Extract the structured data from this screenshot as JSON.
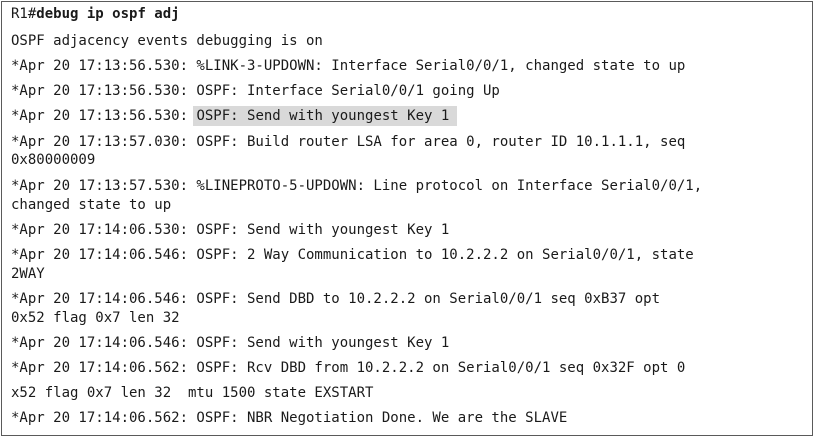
{
  "terminal": {
    "prompt": "R1#",
    "command": "debug ip ospf adj",
    "lines": [
      "OSPF adjacency events debugging is on",
      "*Apr 20 17:13:56.530: %LINK-3-UPDOWN: Interface Serial0/0/1, changed state to up",
      "*Apr 20 17:13:56.530: OSPF: Interface Serial0/0/1 going Up",
      "*Apr 20 17:13:56.530: ",
      "*Apr 20 17:13:57.030: OSPF: Build router LSA for area 0, router ID 10.1.1.1, seq",
      "0x80000009",
      "*Apr 20 17:13:57.530: %LINEPROTO-5-UPDOWN: Line protocol on Interface Serial0/0/1,",
      "changed state to up",
      "*Apr 20 17:14:06.530: OSPF: Send with youngest Key 1",
      "*Apr 20 17:14:06.546: OSPF: 2 Way Communication to 10.2.2.2 on Serial0/0/1, state",
      "2WAY",
      "*Apr 20 17:14:06.546: OSPF: Send DBD to 10.2.2.2 on Serial0/0/1 seq 0xB37 opt",
      "0x52 flag 0x7 len 32",
      "*Apr 20 17:14:06.546: OSPF: Send with youngest Key 1",
      "*Apr 20 17:14:06.562: OSPF: Rcv DBD from 10.2.2.2 on Serial0/0/1 seq 0x32F opt 0",
      "x52 flag 0x7 len 32  mtu 1500 state EXSTART",
      "*Apr 20 17:14:06.562: OSPF: NBR Negotiation Done. We are the SLAVE"
    ],
    "highlight_text": "OSPF: Send with youngest Key 1"
  }
}
